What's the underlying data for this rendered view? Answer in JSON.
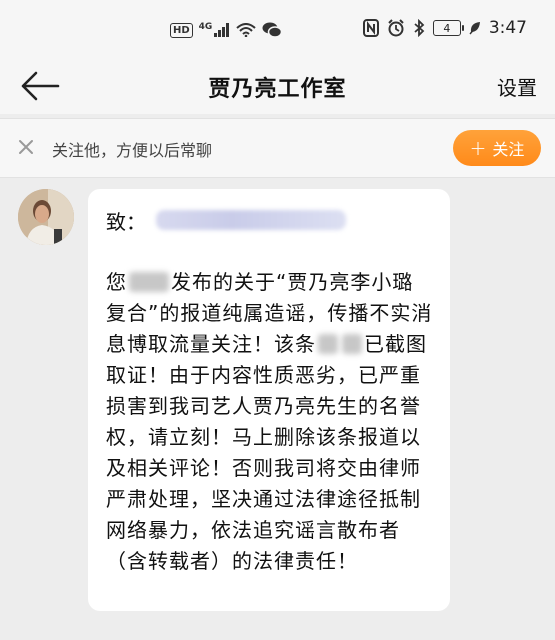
{
  "status_bar": {
    "hd": "HD",
    "network": "4G",
    "battery": "4",
    "time": "3:47"
  },
  "header": {
    "title": "贾乃亮工作室",
    "settings_label": "设置"
  },
  "follow_bar": {
    "text": "关注他，方便以后常聊",
    "button_label": "关注"
  },
  "message": {
    "salutation": "致：",
    "body_before_redaction": "您",
    "body_part1": "发布的关于“贾乃亮李小璐复合”的报道纯属造谣，传播不实消息博取流量关注！该条",
    "body_part2": "已截图取证！由于内容性质恶劣，已严重损害到我司艺人贾乃亮先生的名誉权，请立刻！马上删除该条报道以及相关评论！否则我司将交由律师严肃处理，坚决通过法律途径抵制网络暴力，依法追究谣言散布者（含转载者）的法律责任！"
  },
  "colors": {
    "accent_orange": "#ff8f1f",
    "page_bg": "#ededed",
    "bubble_bg": "#ffffff"
  }
}
